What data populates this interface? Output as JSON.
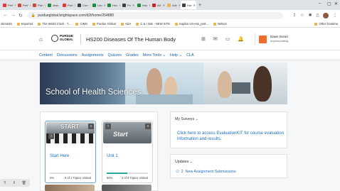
{
  "browser": {
    "tabs": [
      {
        "label": "Perf",
        "color": "#e53935"
      },
      {
        "label": "Perf",
        "color": "#d44638"
      },
      {
        "label": "Fish",
        "color": "#d44638"
      },
      {
        "label": "Jess",
        "color": "#1e8e3e"
      },
      {
        "label": "Fish",
        "color": "#e53935"
      },
      {
        "label": "Curr",
        "color": "#3c4043"
      },
      {
        "label": "Lan",
        "color": "#1e8e3e"
      },
      {
        "label": "Hou",
        "color": "#1e8e3e"
      },
      {
        "label": "Po",
        "color": "#3c4043"
      },
      {
        "label": "Hou",
        "color": "#1e8e3e"
      },
      {
        "label": "AD",
        "color": "#c62828"
      },
      {
        "label": "Adv",
        "color": "#e8b64c"
      },
      {
        "label": "Hor",
        "color": "#3c4043"
      }
    ],
    "url": "purdueglobal.brightspace.com/d2l/home/254880",
    "bookmarks_label": "okmarks",
    "bookmarks": [
      "Imported",
      "The World Clock - T...",
      "CIMS",
      "Purdue Global",
      "ADA",
      "C & I Site - NEW SITE",
      "Kaplan US-ess_port...",
      "Nelson"
    ],
    "other_bookmarks": "Other bookma"
  },
  "header": {
    "logo_line1": "PURDUE",
    "logo_line2": "GLOBAL",
    "course_title": "HS200 Diseases Of The Human Body",
    "user_name": "Dawn Duran",
    "user_role": "Impersonating"
  },
  "nav": {
    "items": [
      "Content",
      "Discussions",
      "Assignments",
      "Quizzes",
      "Grades",
      "More Tools ⌄",
      "Help ⌄",
      "CLA"
    ]
  },
  "banner": {
    "title": "School of Health Sciences"
  },
  "units": [
    {
      "title": "Start Here",
      "percent": 0,
      "percent_label": "0%",
      "visited": "0 of 1 Topics Visited",
      "image_text": "START",
      "selected": true
    },
    {
      "title": "Unit 1",
      "percent": 50,
      "percent_label": "50%",
      "visited": "3 of 6 Topics Visited",
      "image_text": "Start",
      "selected": false
    }
  ],
  "surveys": {
    "title": "My Surveys",
    "link": "Click here to access EvaluationKIT for course evaluation information and results."
  },
  "updates": {
    "title": "Updates",
    "count": "2",
    "text": "New Assignment Submissions"
  }
}
